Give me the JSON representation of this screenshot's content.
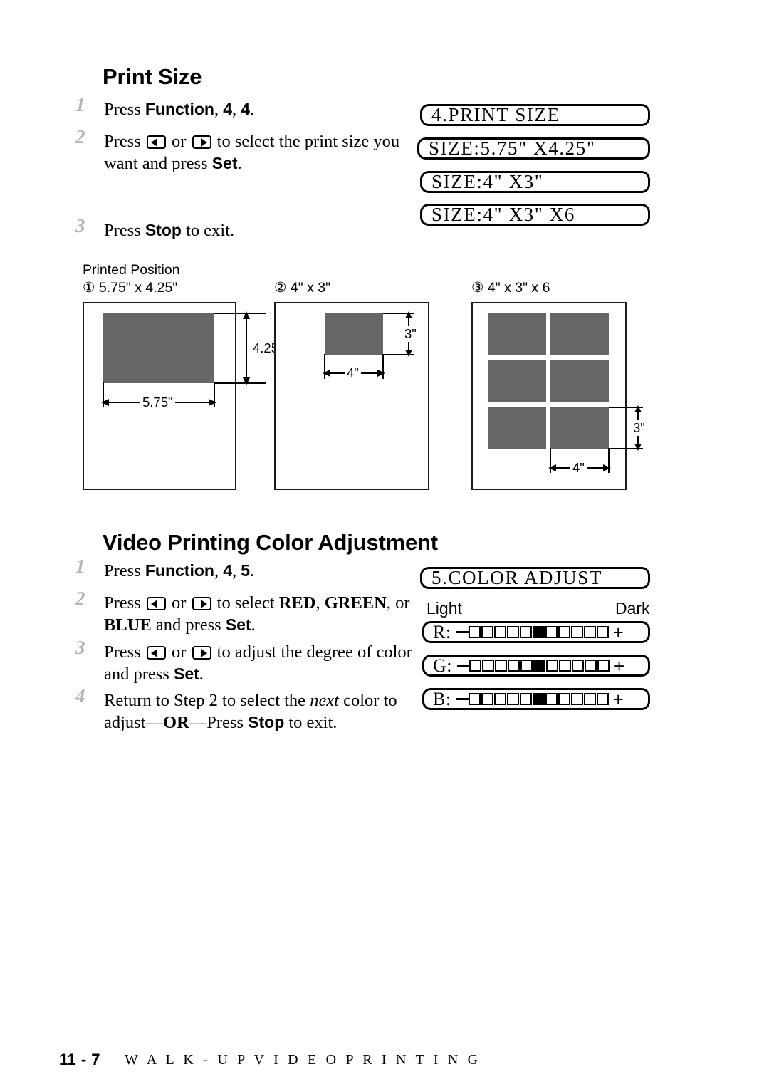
{
  "sections": [
    {
      "heading": "Print Size",
      "steps": [
        {
          "num": "1",
          "parts": [
            "Press ",
            "Function",
            ", ",
            "4",
            ", ",
            "4",
            "."
          ]
        },
        {
          "num": "2",
          "text_a": "Press ",
          "text_b": " or ",
          "text_c": " to select the print size you want and press ",
          "text_d": "Set",
          "text_e": "."
        },
        {
          "num": "3",
          "text_a": "Press ",
          "text_b": "Stop",
          "text_c": " to exit."
        }
      ],
      "lcd": [
        "4.PRINT SIZE",
        "SIZE:5.75\" X4.25\"",
        "SIZE:4\" X3\"",
        "SIZE:4\" X3\" X6"
      ]
    },
    {
      "heading": "Video Printing Color Adjustment",
      "steps": [
        {
          "num": "1",
          "parts": [
            "Press ",
            "Function",
            ", ",
            "4",
            ", ",
            "5",
            "."
          ]
        },
        {
          "num": "2",
          "text_a": "Press ",
          "text_b": " or ",
          "text_c": " to select ",
          "red": "RED",
          "comma1": ", ",
          "green": "GREEN",
          "comma2": ",",
          "text_d": "or ",
          "blue": "BLUE",
          "text_e": " and press ",
          "set": "Set",
          "text_f": "."
        },
        {
          "num": "3",
          "text_a": "Press ",
          "text_b": " or ",
          "text_c": " to adjust the degree of color and press ",
          "set": "Set",
          "text_d": "."
        },
        {
          "num": "4",
          "text_a": "Return to Step 2 to select the ",
          "italic": "next",
          "text_b": " color to adjust",
          "dash1": "—",
          "or": "OR",
          "dash2": "—",
          "text_c": "Press ",
          "stop": "Stop",
          "text_d": " to exit."
        }
      ],
      "lcd_header": "5.COLOR ADJUST",
      "scale_light": "Light",
      "scale_dark": "Dark",
      "bars": [
        {
          "label": "R:",
          "cells_before": 5,
          "filled": 1,
          "cells_after": 5,
          "minus": "—",
          "plus": "+"
        },
        {
          "label": "G:",
          "cells_before": 5,
          "filled": 1,
          "cells_after": 5,
          "minus": "—",
          "plus": "+"
        },
        {
          "label": "B:",
          "cells_before": 5,
          "filled": 1,
          "cells_after": 5,
          "minus": "—",
          "plus": "+"
        }
      ]
    }
  ],
  "diagram": {
    "title": "Printed Position",
    "panels": [
      {
        "caption": "① 5.75\" x 4.25\"",
        "width_label": "5.75\"",
        "height_label": "4.25\""
      },
      {
        "caption": "② 4\" x 3\"",
        "width_label": "4\"",
        "height_label": "3\""
      },
      {
        "caption": "③ 4\" x 3\" x 6",
        "width_label": "4\"",
        "height_label": "3\""
      }
    ]
  },
  "footer": {
    "page": "11 - 7",
    "title": "W A L K - U P   V I D E O   P R I N T I N G"
  },
  "colors": {
    "photo_gray": "#666666",
    "step_number_gray": "#b4b4b4",
    "ink": "#000000"
  }
}
